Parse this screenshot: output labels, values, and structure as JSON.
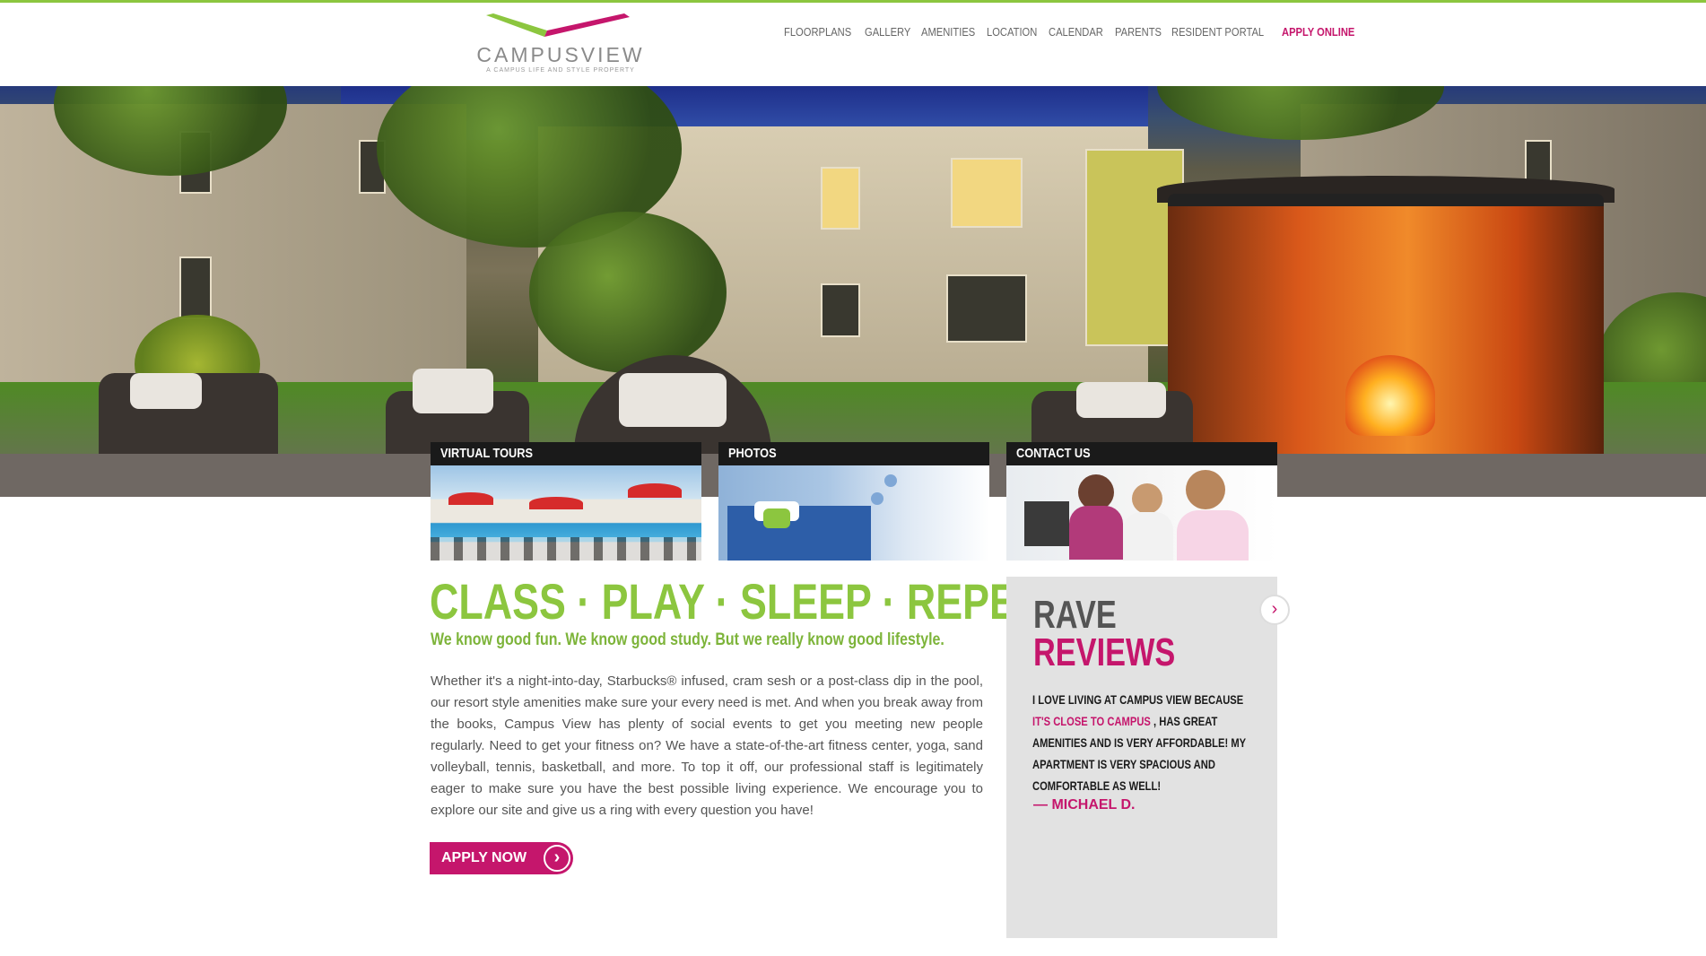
{
  "header": {
    "logo_text": "CAMPUSVIEW",
    "logo_tagline": "A CAMPUS LIFE AND STYLE PROPERTY",
    "nav": [
      {
        "label": "FLOORPLANS"
      },
      {
        "label": "GALLERY"
      },
      {
        "label": "AMENITIES"
      },
      {
        "label": "LOCATION"
      },
      {
        "label": "CALENDAR"
      },
      {
        "label": "PARENTS"
      },
      {
        "label": "RESIDENT PORTAL"
      },
      {
        "label": "APPLY ONLINE"
      }
    ]
  },
  "tiles": [
    {
      "label": "VIRTUAL TOURS"
    },
    {
      "label": "PHOTOS"
    },
    {
      "label": "CONTACT US"
    }
  ],
  "main": {
    "headline": "CLASS · PLAY · SLEEP · REPEAT",
    "subhead": "We know good fun. We know good study. But we really know good lifestyle.",
    "body": "Whether it's a night-into-day, Starbucks® infused, cram sesh or a post-class dip in the pool, our resort style amenities make sure your every need is met. And when you break away from the books, Campus View has plenty of social events to get you meeting new people regularly. Need to get your fitness on? We have a state-of-the-art fitness center, yoga, sand volleyball, tennis, basketball, and more. To top it off, our professional staff is legitimately eager to make sure you have the best possible living experience. We encourage you to explore our site and give us a ring with every question you have!",
    "apply_label": "APPLY NOW"
  },
  "reviews": {
    "title_line1": "RAVE",
    "title_line2": "REVIEWS",
    "quote_before": "I LOVE LIVING AT CAMPUS VIEW BECAUSE ",
    "quote_highlight": "IT'S CLOSE TO CAMPUS",
    "quote_after": " , HAS GREAT AMENITIES AND IS VERY AFFORDABLE! MY APARTMENT IS VERY SPACIOUS AND COMFORTABLE AS WELL!",
    "author": "— MICHAEL D."
  },
  "colors": {
    "accent_green": "#8cc63f",
    "accent_pink": "#c5166c"
  }
}
